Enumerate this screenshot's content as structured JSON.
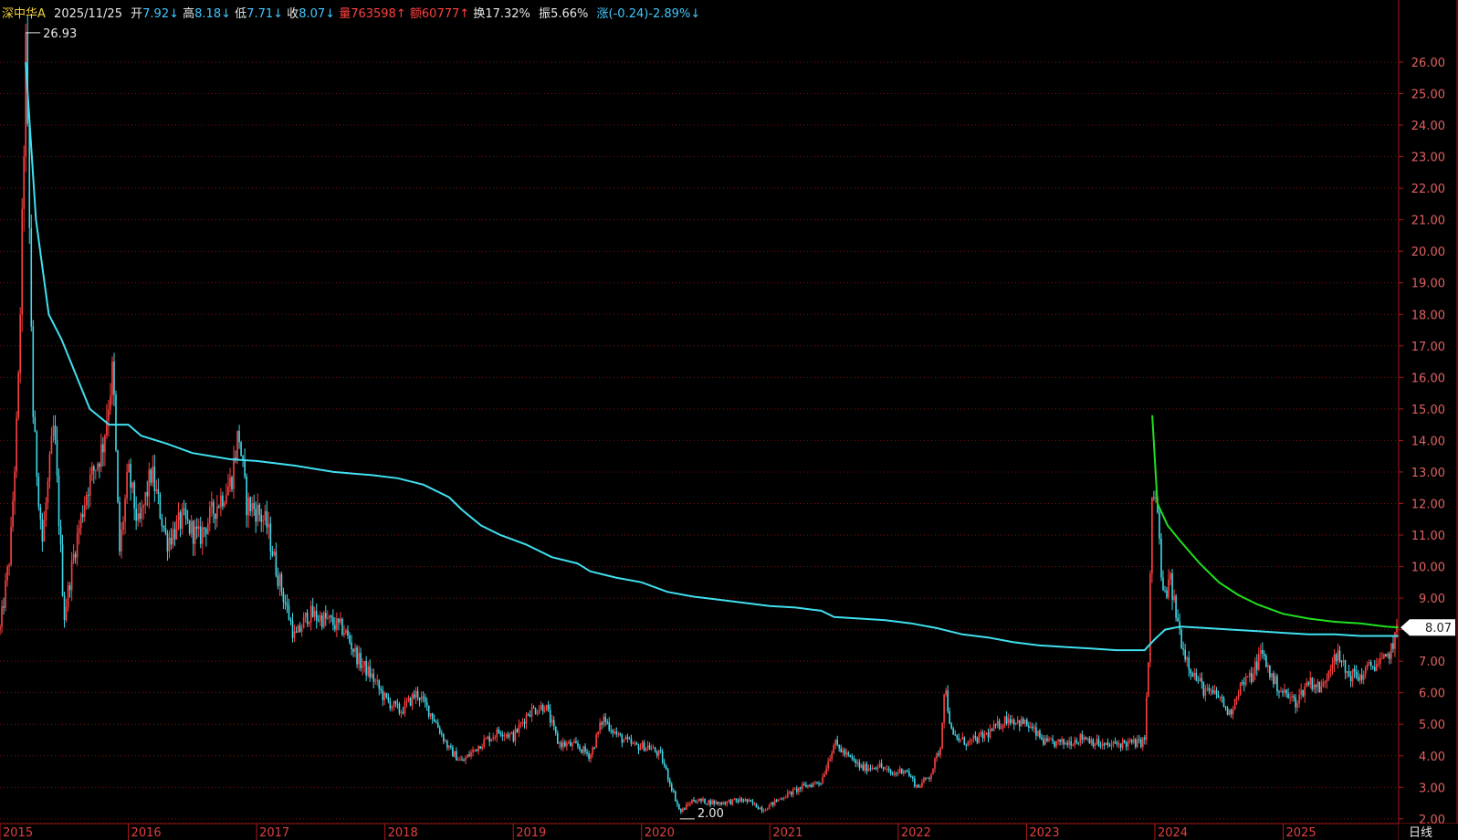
{
  "header": {
    "name": "深中华A",
    "date": "2025/11/25",
    "open_label": "开",
    "open_value": "7.92",
    "open_arrow": "↓",
    "high_label": "高",
    "high_value": "8.18",
    "high_arrow": "↓",
    "low_label": "低",
    "low_value": "7.71",
    "low_arrow": "↓",
    "close_label": "收",
    "close_value": "8.07",
    "close_arrow": "↓",
    "volume_label": "量",
    "volume_value": "763598",
    "volume_arrow": "↑",
    "amount_label": "额",
    "amount_value": "60777",
    "amount_arrow": "↑",
    "turnover_label": "换",
    "turnover_value": "17.32%",
    "amplitude_label": "振",
    "amplitude_value": "5.66%",
    "change_label": "涨",
    "change_value": "(-0.24)-2.89%",
    "change_arrow": "↓"
  },
  "period_tab": "日线",
  "colors": {
    "background": "#000000",
    "grid": "#7a1010",
    "axis": "#b01818",
    "up": "#ff4040",
    "down": "#40d8e8",
    "ma_cyan": "#40e0f0",
    "ma_green": "#20e020",
    "name": "#f0d040",
    "header_text": "#40c8ff",
    "label_white": "#e8e8e8"
  },
  "chart_data": {
    "type": "candlestick",
    "y_ticks": [
      "2.00",
      "3.00",
      "4.00",
      "5.00",
      "6.00",
      "7.00",
      "8.00",
      "9.00",
      "10.00",
      "11.00",
      "12.00",
      "13.00",
      "14.00",
      "15.00",
      "16.00",
      "17.00",
      "18.00",
      "19.00",
      "20.00",
      "21.00",
      "22.00",
      "23.00",
      "24.00",
      "25.00",
      "26.00"
    ],
    "ylim": [
      1.85,
      27.1
    ],
    "x_labels": [
      "2015",
      "2016",
      "2017",
      "2018",
      "2019",
      "2020",
      "2021",
      "2022",
      "2023",
      "2024",
      "2025"
    ],
    "xlim": [
      2015.0,
      2025.9
    ],
    "grid": "horizontal-dotted",
    "annotations": {
      "max_label": "26.93",
      "max_x": 2015.2,
      "max_y": 26.93,
      "min_label": "2.00",
      "min_x": 2020.3,
      "min_y": 2.0,
      "last_price": "8.07",
      "last_x": 2025.9,
      "last_y": 8.07
    },
    "price_path": [
      [
        2015.0,
        8.0
      ],
      [
        2015.08,
        10.5
      ],
      [
        2015.14,
        15.2
      ],
      [
        2015.18,
        22.0
      ],
      [
        2015.2,
        26.5
      ],
      [
        2015.26,
        14.5
      ],
      [
        2015.33,
        10.8
      ],
      [
        2015.42,
        14.5
      ],
      [
        2015.5,
        8.4
      ],
      [
        2015.58,
        10.5
      ],
      [
        2015.68,
        12.5
      ],
      [
        2015.8,
        13.8
      ],
      [
        2015.88,
        16.3
      ],
      [
        2015.93,
        10.4
      ],
      [
        2016.0,
        13.0
      ],
      [
        2016.08,
        11.2
      ],
      [
        2016.18,
        13.0
      ],
      [
        2016.3,
        10.8
      ],
      [
        2016.42,
        11.5
      ],
      [
        2016.55,
        10.9
      ],
      [
        2016.68,
        11.9
      ],
      [
        2016.8,
        12.7
      ],
      [
        2016.86,
        14.3
      ],
      [
        2016.92,
        12.0
      ],
      [
        2017.0,
        11.8
      ],
      [
        2017.08,
        11.3
      ],
      [
        2017.16,
        9.8
      ],
      [
        2017.24,
        8.6
      ],
      [
        2017.3,
        7.7
      ],
      [
        2017.4,
        8.5
      ],
      [
        2017.55,
        8.3
      ],
      [
        2017.68,
        8.0
      ],
      [
        2017.8,
        7.0
      ],
      [
        2017.9,
        6.5
      ],
      [
        2018.0,
        5.8
      ],
      [
        2018.12,
        5.4
      ],
      [
        2018.25,
        6.0
      ],
      [
        2018.38,
        5.2
      ],
      [
        2018.5,
        4.2
      ],
      [
        2018.6,
        3.8
      ],
      [
        2018.75,
        4.4
      ],
      [
        2018.9,
        4.8
      ],
      [
        2019.0,
        4.6
      ],
      [
        2019.12,
        5.4
      ],
      [
        2019.25,
        5.6
      ],
      [
        2019.35,
        4.4
      ],
      [
        2019.5,
        4.3
      ],
      [
        2019.6,
        4.0
      ],
      [
        2019.7,
        5.2
      ],
      [
        2019.82,
        4.6
      ],
      [
        2019.95,
        4.3
      ],
      [
        2020.05,
        4.3
      ],
      [
        2020.15,
        4.0
      ],
      [
        2020.3,
        2.2
      ],
      [
        2020.4,
        2.6
      ],
      [
        2020.6,
        2.5
      ],
      [
        2020.8,
        2.6
      ],
      [
        2020.95,
        2.3
      ],
      [
        2021.1,
        2.7
      ],
      [
        2021.25,
        3.0
      ],
      [
        2021.4,
        3.2
      ],
      [
        2021.5,
        4.4
      ],
      [
        2021.6,
        4.0
      ],
      [
        2021.72,
        3.6
      ],
      [
        2021.85,
        3.7
      ],
      [
        2021.95,
        3.4
      ],
      [
        2022.05,
        3.6
      ],
      [
        2022.15,
        3.0
      ],
      [
        2022.25,
        3.4
      ],
      [
        2022.33,
        4.3
      ],
      [
        2022.36,
        6.3
      ],
      [
        2022.42,
        4.6
      ],
      [
        2022.55,
        4.4
      ],
      [
        2022.7,
        4.7
      ],
      [
        2022.85,
        5.2
      ],
      [
        2023.0,
        5.0
      ],
      [
        2023.15,
        4.4
      ],
      [
        2023.3,
        4.4
      ],
      [
        2023.45,
        4.6
      ],
      [
        2023.6,
        4.3
      ],
      [
        2023.75,
        4.4
      ],
      [
        2023.88,
        4.4
      ],
      [
        2023.92,
        4.5
      ],
      [
        2023.95,
        7.0
      ],
      [
        2023.98,
        12.5
      ],
      [
        2024.02,
        11.8
      ],
      [
        2024.06,
        9.0
      ],
      [
        2024.12,
        9.5
      ],
      [
        2024.17,
        8.4
      ],
      [
        2024.22,
        7.4
      ],
      [
        2024.3,
        6.6
      ],
      [
        2024.4,
        6.0
      ],
      [
        2024.5,
        5.9
      ],
      [
        2024.58,
        5.3
      ],
      [
        2024.66,
        6.2
      ],
      [
        2024.75,
        6.5
      ],
      [
        2024.83,
        7.3
      ],
      [
        2024.92,
        6.4
      ],
      [
        2025.0,
        6.0
      ],
      [
        2025.1,
        5.7
      ],
      [
        2025.2,
        6.4
      ],
      [
        2025.3,
        6.1
      ],
      [
        2025.4,
        7.3
      ],
      [
        2025.5,
        6.6
      ],
      [
        2025.6,
        6.5
      ],
      [
        2025.7,
        6.9
      ],
      [
        2025.8,
        7.0
      ],
      [
        2025.86,
        7.6
      ],
      [
        2025.9,
        8.07
      ]
    ],
    "ma_cyan": [
      [
        2015.2,
        26.0
      ],
      [
        2015.28,
        21.0
      ],
      [
        2015.38,
        18.0
      ],
      [
        2015.48,
        17.2
      ],
      [
        2015.58,
        16.2
      ],
      [
        2015.7,
        15.0
      ],
      [
        2015.85,
        14.5
      ],
      [
        2016.0,
        14.5
      ],
      [
        2016.1,
        14.15
      ],
      [
        2016.3,
        13.9
      ],
      [
        2016.5,
        13.6
      ],
      [
        2016.8,
        13.4
      ],
      [
        2017.0,
        13.35
      ],
      [
        2017.3,
        13.2
      ],
      [
        2017.6,
        13.0
      ],
      [
        2017.9,
        12.9
      ],
      [
        2018.1,
        12.8
      ],
      [
        2018.3,
        12.6
      ],
      [
        2018.5,
        12.2
      ],
      [
        2018.6,
        11.8
      ],
      [
        2018.75,
        11.3
      ],
      [
        2018.9,
        11.0
      ],
      [
        2019.1,
        10.7
      ],
      [
        2019.3,
        10.3
      ],
      [
        2019.5,
        10.1
      ],
      [
        2019.6,
        9.85
      ],
      [
        2019.8,
        9.65
      ],
      [
        2020.0,
        9.5
      ],
      [
        2020.2,
        9.2
      ],
      [
        2020.4,
        9.05
      ],
      [
        2020.6,
        8.95
      ],
      [
        2020.8,
        8.85
      ],
      [
        2021.0,
        8.75
      ],
      [
        2021.2,
        8.7
      ],
      [
        2021.4,
        8.6
      ],
      [
        2021.5,
        8.4
      ],
      [
        2021.7,
        8.35
      ],
      [
        2021.9,
        8.3
      ],
      [
        2022.1,
        8.2
      ],
      [
        2022.3,
        8.05
      ],
      [
        2022.5,
        7.85
      ],
      [
        2022.7,
        7.75
      ],
      [
        2022.9,
        7.6
      ],
      [
        2023.1,
        7.5
      ],
      [
        2023.3,
        7.45
      ],
      [
        2023.5,
        7.4
      ],
      [
        2023.7,
        7.35
      ],
      [
        2023.92,
        7.35
      ],
      [
        2024.0,
        7.7
      ],
      [
        2024.08,
        8.0
      ],
      [
        2024.2,
        8.1
      ],
      [
        2024.4,
        8.05
      ],
      [
        2024.6,
        8.0
      ],
      [
        2024.8,
        7.95
      ],
      [
        2025.0,
        7.9
      ],
      [
        2025.2,
        7.85
      ],
      [
        2025.4,
        7.85
      ],
      [
        2025.6,
        7.8
      ],
      [
        2025.8,
        7.8
      ],
      [
        2025.9,
        7.8
      ]
    ],
    "ma_green": [
      [
        2023.98,
        14.8
      ],
      [
        2024.02,
        12.0
      ],
      [
        2024.1,
        11.3
      ],
      [
        2024.2,
        10.8
      ],
      [
        2024.35,
        10.1
      ],
      [
        2024.5,
        9.5
      ],
      [
        2024.65,
        9.1
      ],
      [
        2024.8,
        8.8
      ],
      [
        2025.0,
        8.5
      ],
      [
        2025.2,
        8.35
      ],
      [
        2025.4,
        8.25
      ],
      [
        2025.6,
        8.2
      ],
      [
        2025.8,
        8.1
      ],
      [
        2025.9,
        8.07
      ]
    ]
  }
}
